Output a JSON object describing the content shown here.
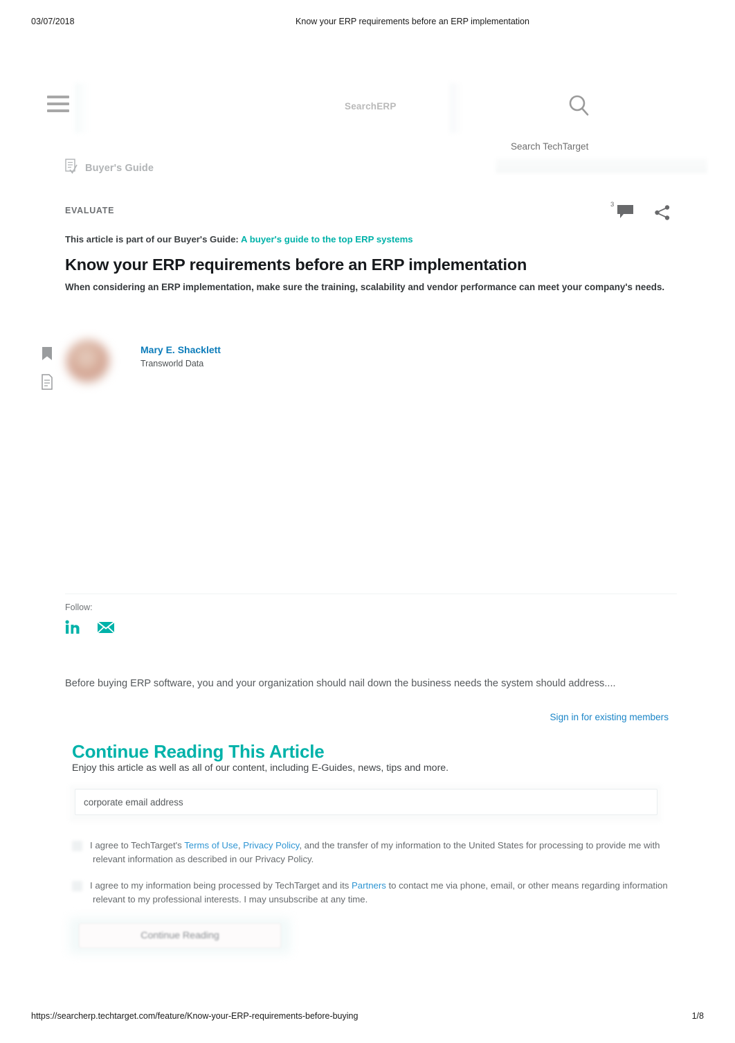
{
  "print": {
    "date": "03/07/2018",
    "title": "Know your ERP requirements before an ERP implementation",
    "url": "https://searcherp.techtarget.com/feature/Know-your-ERP-requirements-before-buying",
    "page": "1/8"
  },
  "nav": {
    "menu_icon": "hamburger-menu-icon",
    "brand": "SearchERP",
    "search_icon": "search-icon",
    "search_techtarget_label": "Search TechTarget",
    "buyers_guide_label": "Buyer's Guide",
    "buyers_guide_icon": "clipboard-checklist-icon"
  },
  "article": {
    "eyebrow": "EVALUATE",
    "comment_count": "3",
    "comment_icon": "comment-bubble-icon",
    "share_icon": "share-icon",
    "guide_prefix": "This article is part of our Buyer's Guide:",
    "guide_link": "A buyer's guide to the top ERP systems",
    "headline": "Know your ERP requirements before an ERP implementation",
    "standfirst": "When considering an ERP implementation, make sure the training, scalability and vendor performance can meet your company's needs.",
    "teaser": "Before buying ERP software, you and your organization should nail down the business needs the system should address....",
    "signin_link": "Sign in for existing members"
  },
  "rail": {
    "bookmark_icon": "bookmark-icon",
    "document_icon": "document-icon"
  },
  "author": {
    "name": "Mary E. Shacklett",
    "org": "Transworld Data",
    "avatar_icon": "author-avatar"
  },
  "follow": {
    "label": "Follow:",
    "linkedin_icon": "linkedin-icon",
    "email_icon": "envelope-icon"
  },
  "gate": {
    "title": "Continue Reading This Article",
    "subtitle": "Enjoy this article as well as all of our content, including E-Guides, news, tips and more.",
    "email_placeholder": "corporate email address",
    "email_value": "",
    "consent_1": {
      "part_1": "I agree to TechTarget's ",
      "link_1": "Terms of Use",
      "sep_1": ", ",
      "link_2": "Privacy Policy",
      "part_2": ", and the transfer of my information to the United States for processing to provide me with relevant information as described in our Privacy Policy."
    },
    "consent_2": {
      "part_1": "I agree to my information being processed by TechTarget and its ",
      "link_1": "Partners",
      "part_2": " to contact me via phone, email, or other means regarding information relevant to my professional interests. I may unsubscribe at any time."
    },
    "cta_label": "Continue Reading"
  },
  "colors": {
    "teal": "#00b2a9",
    "link_blue": "#1a85c7",
    "author_blue": "#0c7cba",
    "gray_text": "#55595c"
  }
}
